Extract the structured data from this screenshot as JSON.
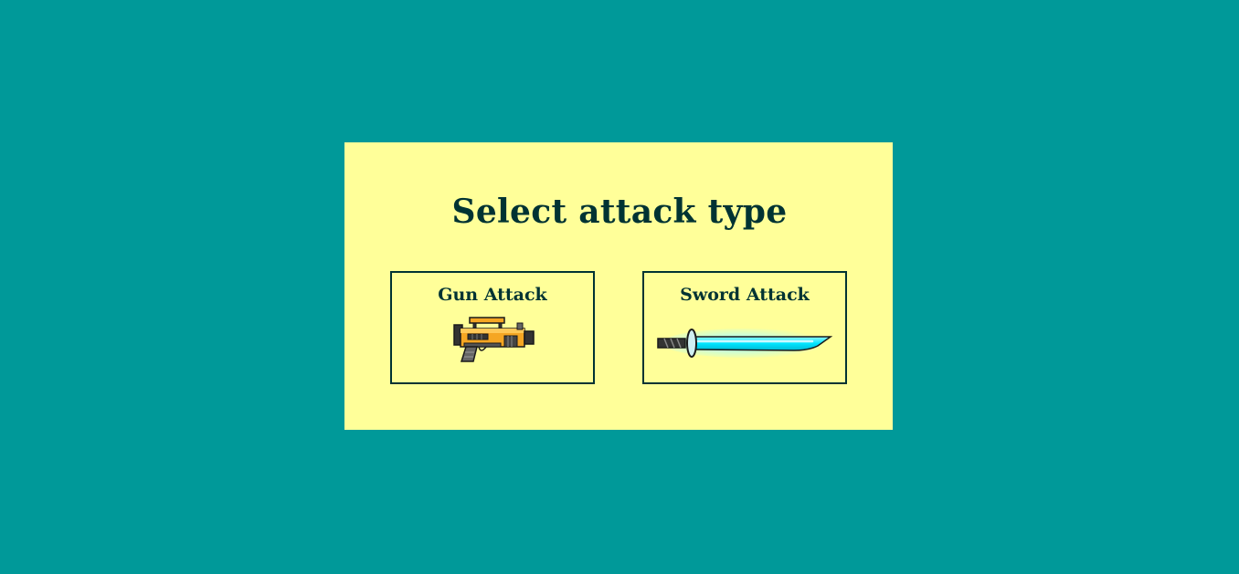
{
  "theme": {
    "background": "#009999",
    "panel": "#ffff99",
    "ink": "#003333",
    "gun_orange": "#f5a623",
    "gun_dark": "#333333",
    "sword_blade": "#00e5ff",
    "sword_glow": "#aaffff"
  },
  "dialog": {
    "title": "Select attack type",
    "options": [
      {
        "id": "gun",
        "label": "Gun Attack",
        "icon": "blaster-gun-icon"
      },
      {
        "id": "sword",
        "label": "Sword Attack",
        "icon": "glowing-sword-icon"
      }
    ]
  }
}
